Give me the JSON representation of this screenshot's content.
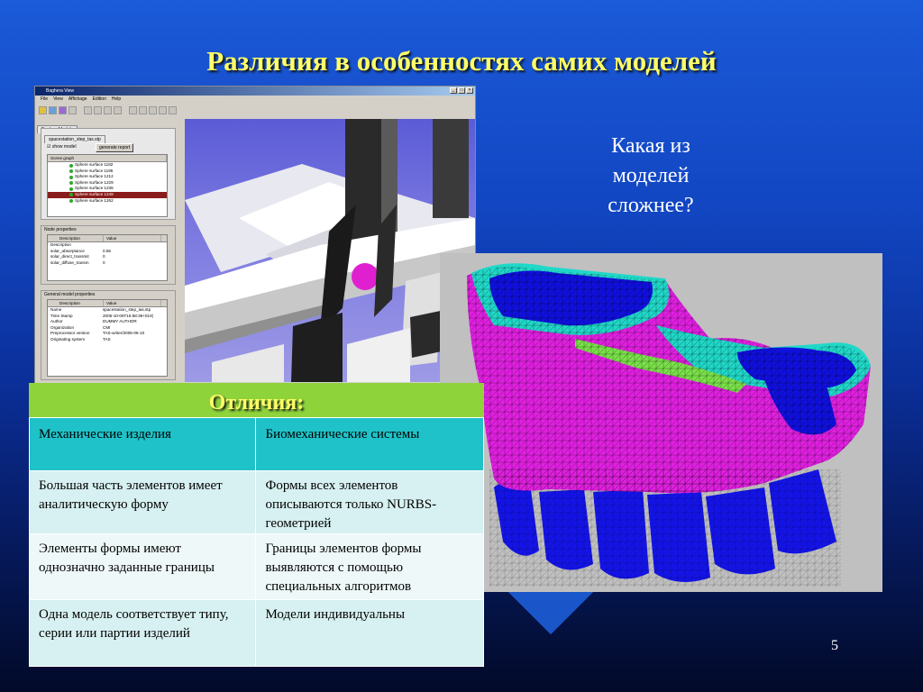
{
  "slide": {
    "title": "Различия в особенностях самих моделей",
    "question": "Какая из моделей сложнее?",
    "page_number": "5"
  },
  "app": {
    "window_title": "Baghera View",
    "menu": [
      "File",
      "View",
      "Affichage",
      "Edition",
      "Help"
    ],
    "tab": "BagheraModule",
    "file_tab": "spacestation_step_tas.stp",
    "show_model": "show model",
    "generate_report": "generate report",
    "scene_graph": {
      "label": "Scene graph",
      "items": [
        "Sphere surface 1182",
        "Sphere surface 1195",
        "Sphere surface 1212",
        "Sphere surface 1229",
        "Sphere surface 1236",
        "Sphere surface 1249",
        "Sphere surface 1262"
      ],
      "selected_index": 5
    },
    "node_properties": {
      "label": "Node properties",
      "headers": [
        "Description",
        "Value"
      ],
      "rows": [
        {
          "k": "Description",
          "v": ""
        },
        {
          "k": "solar_absorptance",
          "v": "0.55"
        },
        {
          "k": "solar_direct_transmit",
          "v": "0"
        },
        {
          "k": "solar_diffuse_transm",
          "v": "0"
        }
      ]
    },
    "general_properties": {
      "label": "General model properties",
      "headers": [
        "Description",
        "Value"
      ],
      "rows": [
        {
          "k": "Name",
          "v": "spacestation_step_tas.stp"
        },
        {
          "k": "Time Stamp",
          "v": "2005-10-05T16:58:39+010("
        },
        {
          "k": "Author",
          "v": "DUMMY AUTHOR"
        },
        {
          "k": "Organization",
          "v": "CMI"
        },
        {
          "k": "Preprocessor version",
          "v": "TAS-writer/2005-06-10"
        },
        {
          "k": "Originating system",
          "v": "TAS"
        }
      ]
    }
  },
  "table": {
    "title": "Отличия:",
    "headers": [
      "Механические изделия",
      "Биомеханические системы"
    ],
    "rows": [
      [
        "Большая часть элементов имеет аналитическую форму",
        "Формы всех элементов описываются только NURBS-геометрией"
      ],
      [
        "Элементы формы имеют однозначно заданные границы",
        "Границы элементов формы выявляются с помощью специальных алгоритмов"
      ],
      [
        "Одна модель соответствует типу, серии или партии изделий",
        "Модели индивидуальны"
      ]
    ]
  },
  "colors": {
    "title": "#ffff66",
    "table_header": "#1fc2c8",
    "table_title_bar": "#8fd33a",
    "mesh_magenta": "#e020e0",
    "mesh_blue": "#1010e0",
    "mesh_cyan": "#20d8c8"
  }
}
